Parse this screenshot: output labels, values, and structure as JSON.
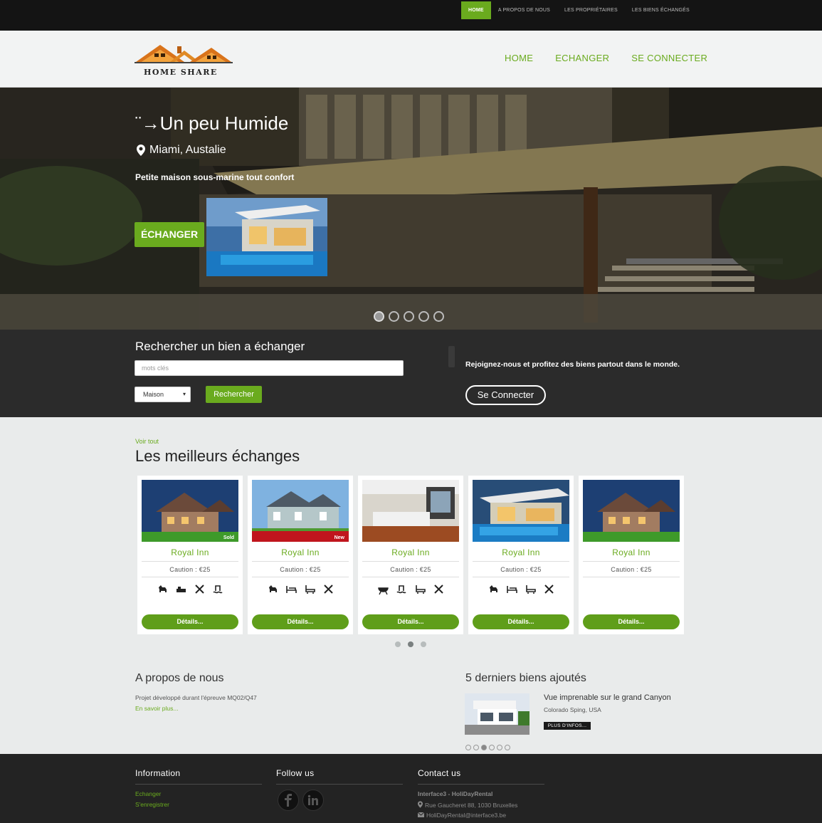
{
  "topnav": {
    "items": [
      "HOME",
      "A PROPOS DE NOUS",
      "LES PROPRIÉTAIRES",
      "LES BIENS ÉCHANGÉS"
    ]
  },
  "header": {
    "logo_text": "HOME SHARE",
    "nav": [
      "HOME",
      "ECHANGER",
      "SE CONNECTER"
    ]
  },
  "hero": {
    "title": "Un peu Humide",
    "location": "Miami, Austalie",
    "description": "Petite maison sous-marine tout confort",
    "button": "ÉCHANGER",
    "slides_total": 5,
    "slide_active": 1
  },
  "search": {
    "title": "Rechercher un bien a échanger",
    "keywords_placeholder": "mots clés",
    "type_selected": "Maison",
    "button": "Rechercher",
    "join_text": "Rejoignez-nous et profitez des biens partout dans le monde.",
    "connect_button": "Se Connecter"
  },
  "best": {
    "see_all": "Voir tout",
    "title": "Les meilleurs échanges",
    "cards": [
      {
        "name": "Royal Inn",
        "price": "Caution : €25",
        "badge": "Sold",
        "badge_color": "#6aab1e",
        "button": "Détails...",
        "features": [
          "dog-icon",
          "sofa-icon",
          "tools-icon",
          "pool-icon"
        ]
      },
      {
        "name": "Royal Inn",
        "price": "Caution : €25",
        "badge": "New",
        "badge_color": "#c0151d",
        "button": "Détails...",
        "features": [
          "dog-icon",
          "bed-icon",
          "bath-icon",
          "tools-icon"
        ]
      },
      {
        "name": "Royal Inn",
        "price": "Caution : €25",
        "badge": "",
        "badge_color": "",
        "button": "Détails...",
        "features": [
          "bbq-icon",
          "pool-icon",
          "bath-icon",
          "tools-icon"
        ]
      },
      {
        "name": "Royal Inn",
        "price": "Caution : €25",
        "badge": "",
        "badge_color": "",
        "button": "Détails...",
        "features": [
          "dog-icon",
          "bed-icon",
          "bath-icon",
          "tools-icon"
        ]
      },
      {
        "name": "Royal Inn",
        "price": "Caution : €25",
        "badge": "",
        "badge_color": "",
        "button": "Détails...",
        "features": []
      }
    ],
    "pages_total": 3,
    "page_active": 2
  },
  "about": {
    "title": "A propos de nous",
    "text": "Projet développé durant l'épreuve MQ02/Q47",
    "more": "En savoir plus..."
  },
  "latest": {
    "title": "5 derniers biens ajoutés",
    "item_title": "Vue imprenable sur le grand Canyon",
    "item_location": "Colorado Sping, USA",
    "button": "PLUS D'INFOS...",
    "slides_total": 6,
    "slide_active": 3
  },
  "footer": {
    "info_title": "Information",
    "info_links": [
      "Echanger",
      "S'enregistrer"
    ],
    "follow_title": "Follow us",
    "contact_title": "Contact us",
    "contact_name": "Interface3 - HoliDayRental",
    "contact_address": "Rue Gaucheret 88, 1030 Bruxelles",
    "contact_email": "HoliDayRental@interface3.be"
  },
  "colors": {
    "accent": "#6aab1e",
    "topbar": "#141414",
    "band": "#2b2b2b",
    "footer": "#232323"
  }
}
